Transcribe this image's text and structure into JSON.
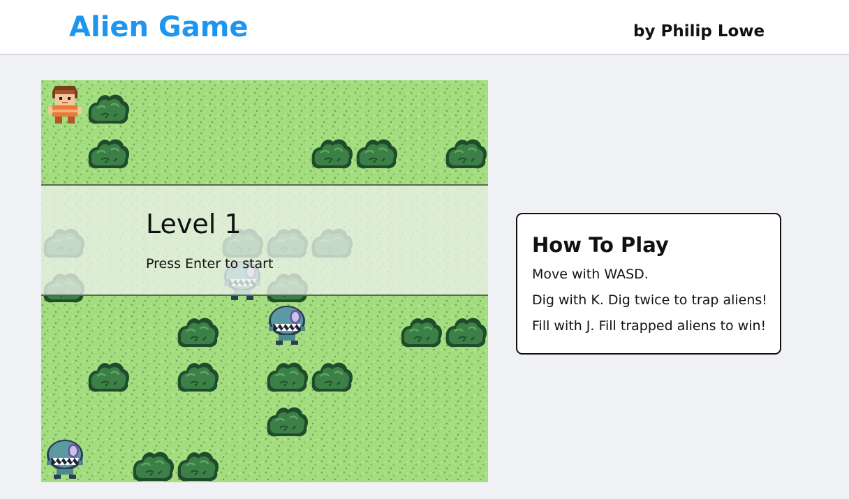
{
  "header": {
    "title": "Alien Game",
    "byline": "by Philip Lowe"
  },
  "game": {
    "overlay": {
      "level_title": "Level 1",
      "hint": "Press Enter to start"
    },
    "sprites": {
      "player": "player-icon",
      "bush": "bush-icon",
      "alien": "alien-icon"
    }
  },
  "help": {
    "title": "How To Play",
    "lines": [
      "Move with WASD.",
      "Dig with K. Dig twice to trap aliens!",
      "Fill with J. Fill trapped aliens to win!"
    ]
  },
  "colors": {
    "accent": "#1e96f0",
    "grass": "#a4dc80",
    "bush": "#2d6a3c",
    "background": "#f0f1f5"
  }
}
